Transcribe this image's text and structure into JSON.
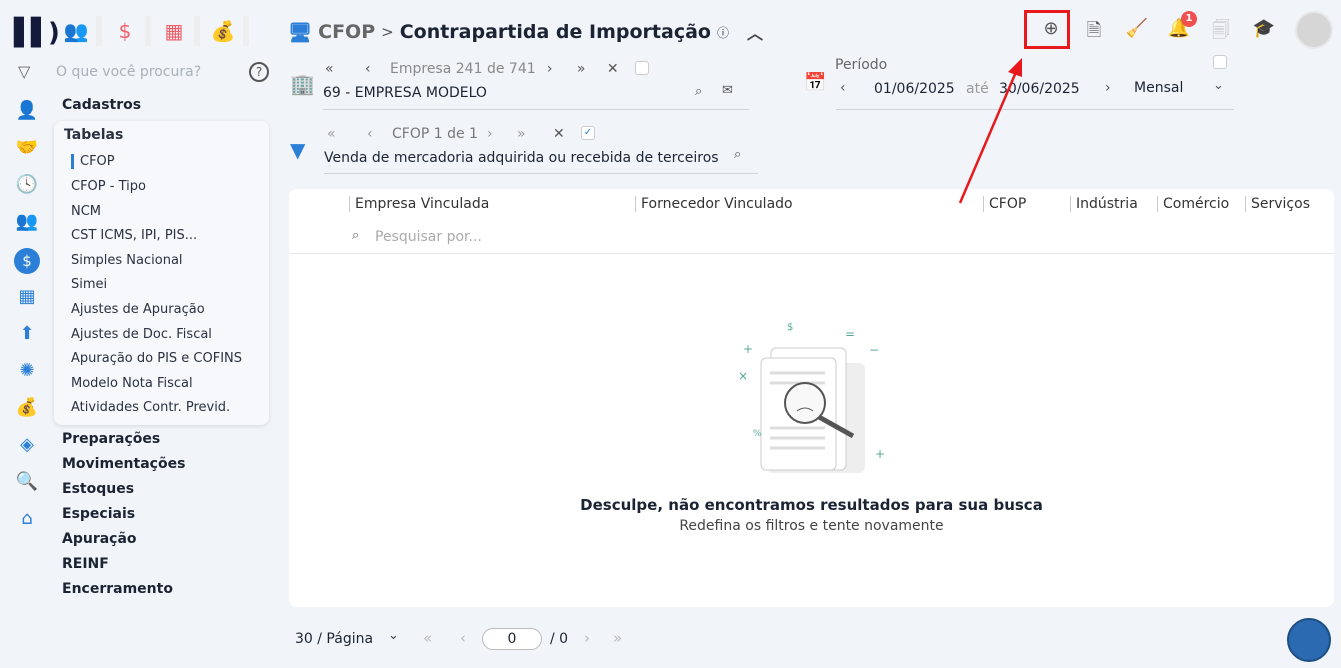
{
  "top_apps": [
    {
      "icon": "people-icon",
      "glyph": "👥"
    },
    {
      "icon": "dollar-icon",
      "glyph": "$"
    },
    {
      "icon": "calculator-icon",
      "glyph": "▦"
    },
    {
      "icon": "money-bag-icon",
      "glyph": "💰"
    }
  ],
  "search": {
    "placeholder": "O que você procura?",
    "help": "?"
  },
  "menu": {
    "cadastros": "Cadastros",
    "tabelas": "Tabelas",
    "tabelas_items": [
      "CFOP",
      "CFOP - Tipo",
      "NCM",
      "CST ICMS, IPI, PIS...",
      "Simples Nacional",
      "Simei",
      "Ajustes de Apuração",
      "Ajustes de Doc. Fiscal",
      "Apuração do PIS e COFINS",
      "Modelo Nota Fiscal",
      "Atividades Contr. Previd."
    ],
    "others": [
      "Preparações",
      "Movimentações",
      "Estoques",
      "Especiais",
      "Apuração",
      "REINF",
      "Encerramento"
    ]
  },
  "header": {
    "parent": "CFOP",
    "sep": ">",
    "title": "Contrapartida de Importação",
    "info": "ⓘ"
  },
  "empresa": {
    "label": "Empresa",
    "current": "241",
    "of": "de",
    "total": "741",
    "value": "69 - EMPRESA MODELO"
  },
  "cfop_filter": {
    "label": "CFOP 1 de 1",
    "value": "Venda de mercadoria adquirida ou recebida de terceiros"
  },
  "periodo": {
    "label": "Período",
    "start": "01/06/2025",
    "ate": "até",
    "end": "30/06/2025",
    "mode": "Mensal"
  },
  "notifications": {
    "count": "1"
  },
  "table": {
    "columns": [
      "Empresa Vinculada",
      "Fornecedor Vinculado",
      "CFOP",
      "Indústria",
      "Comércio",
      "Serviços"
    ],
    "search_placeholder": "Pesquisar por..."
  },
  "empty": {
    "title": "Desculpe, não encontramos resultados para sua busca",
    "subtitle": "Redefina os filtros e tente novamente"
  },
  "pagination": {
    "per_page": "30 / Página",
    "page": "0",
    "total": "/ 0"
  },
  "colors": {
    "accent": "#2b7fd6",
    "annotation": "#e8191c"
  }
}
